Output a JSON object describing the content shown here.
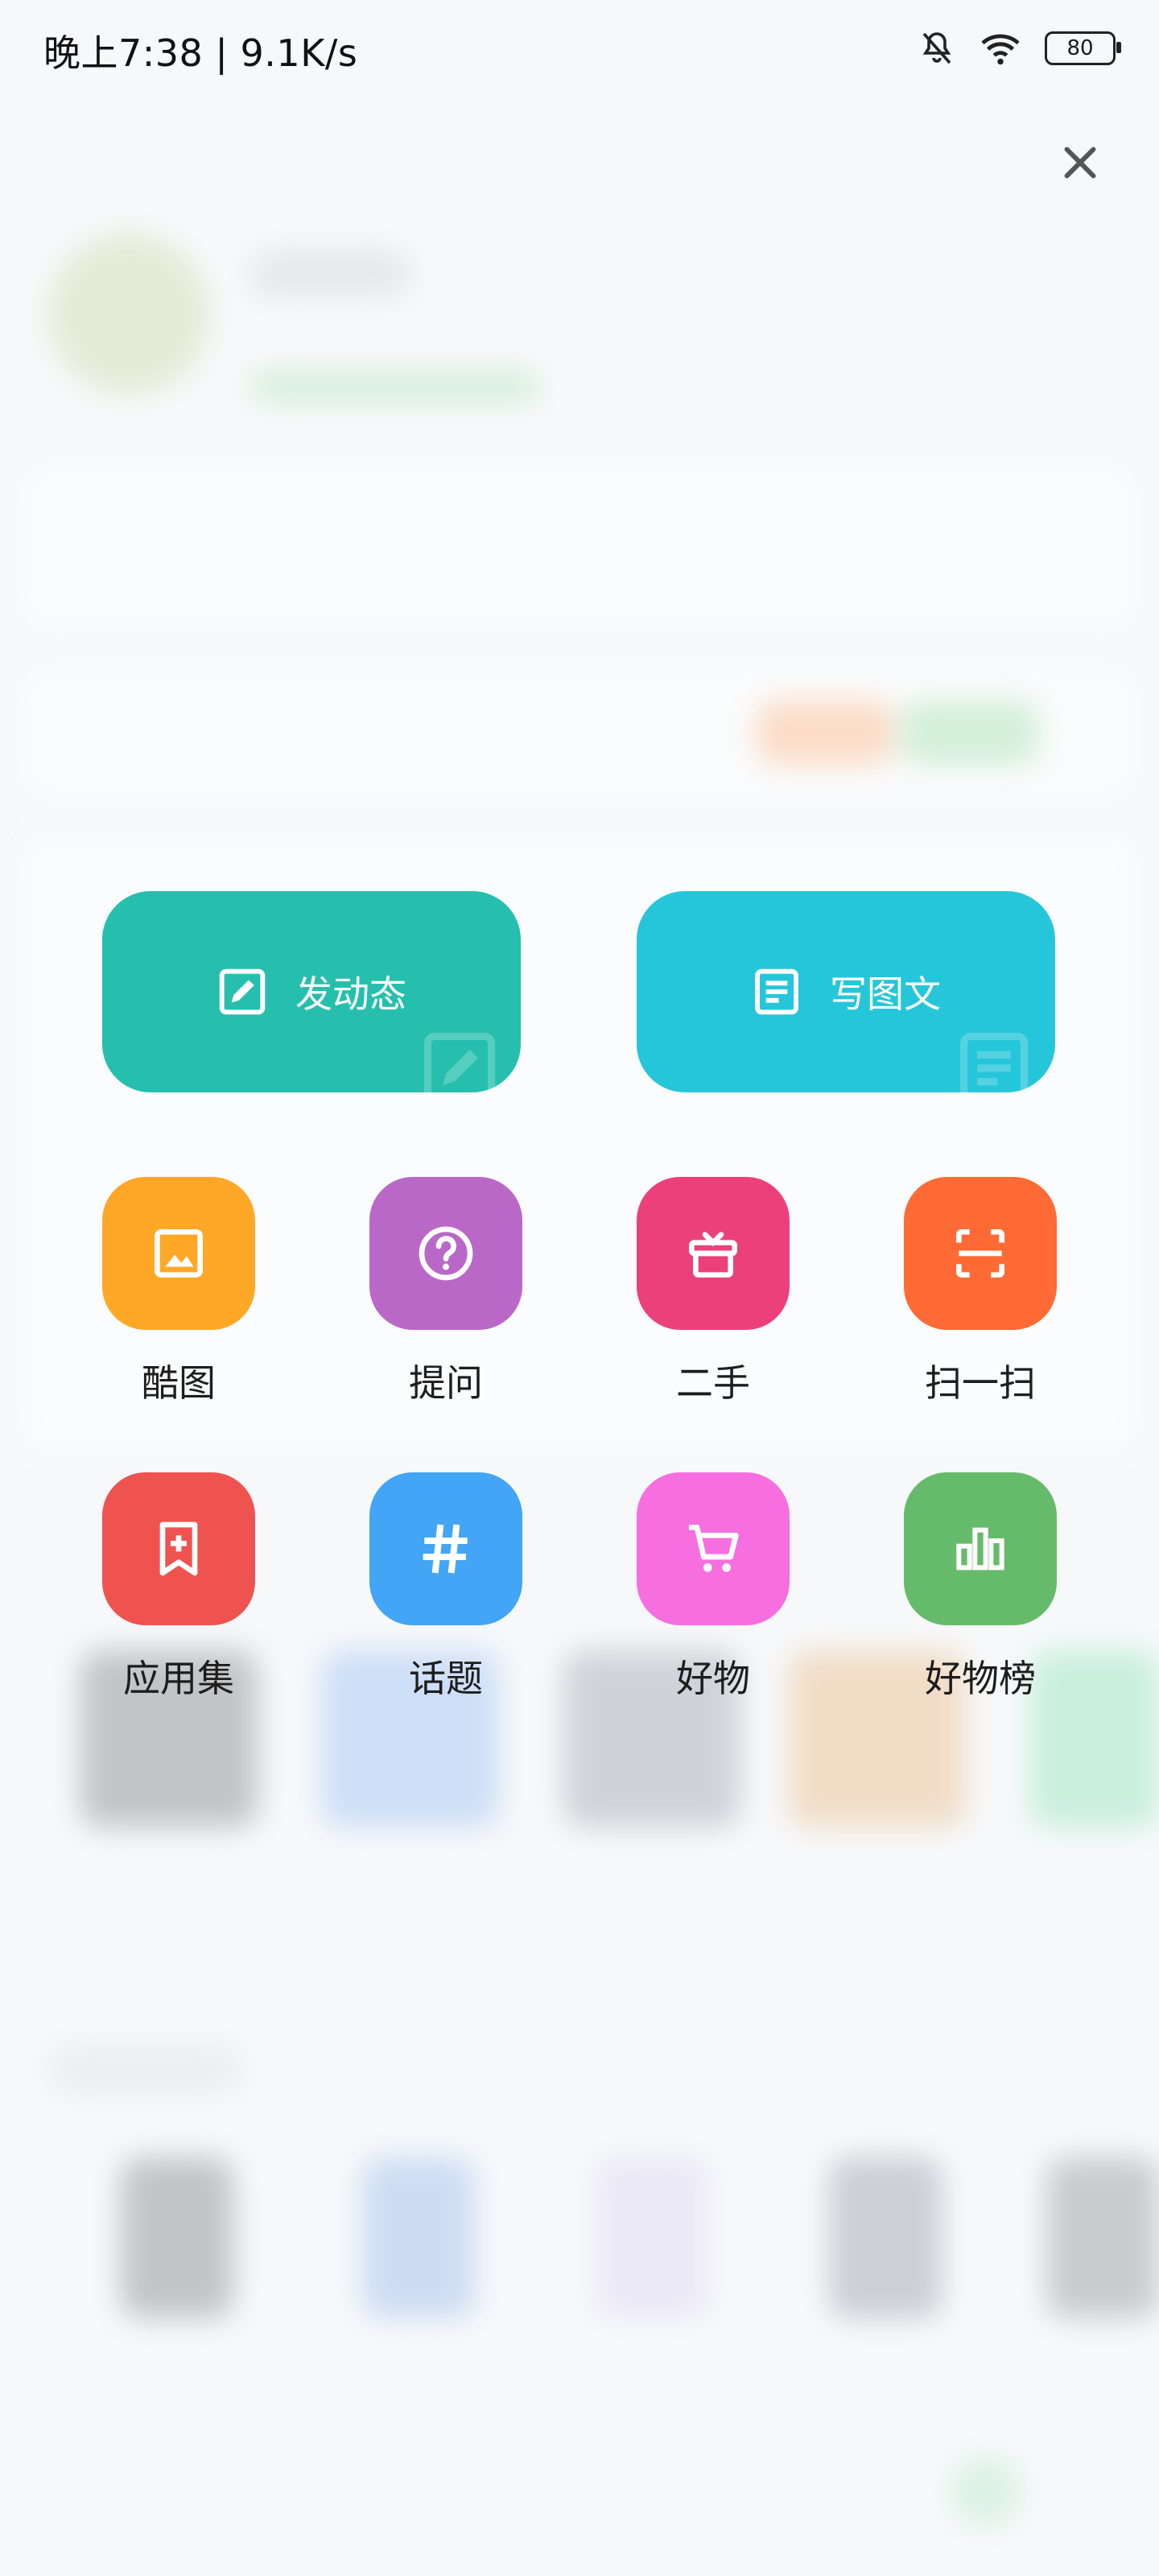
{
  "status_bar": {
    "time": "晚上7:38 | 9.1K/s",
    "battery": "80",
    "icons": [
      "bell-muted-icon",
      "wifi-icon",
      "battery-icon"
    ]
  },
  "close_icon": "close-icon",
  "actions": {
    "post": {
      "label": "发动态",
      "color": "#26bfae",
      "icon": "edit-icon"
    },
    "article": {
      "label": "写图文",
      "color": "#26c6da",
      "icon": "document-icon"
    }
  },
  "grid": [
    {
      "label": "酷图",
      "color": "#ffa726",
      "icon": "image-icon"
    },
    {
      "label": "提问",
      "color": "#ba68c8",
      "icon": "question-icon"
    },
    {
      "label": "二手",
      "color": "#ec407a",
      "icon": "gift-box-icon"
    },
    {
      "label": "扫一扫",
      "color": "#ff6a35",
      "icon": "scan-icon"
    },
    {
      "label": "应用集",
      "color": "#ef5350",
      "icon": "bookmark-plus-icon"
    },
    {
      "label": "话题",
      "color": "#42a5f5",
      "icon": "hashtag-icon"
    },
    {
      "label": "好物",
      "color": "#f76ee0",
      "icon": "cart-icon"
    },
    {
      "label": "好物榜",
      "color": "#66bb6a",
      "icon": "bar-chart-icon"
    }
  ]
}
